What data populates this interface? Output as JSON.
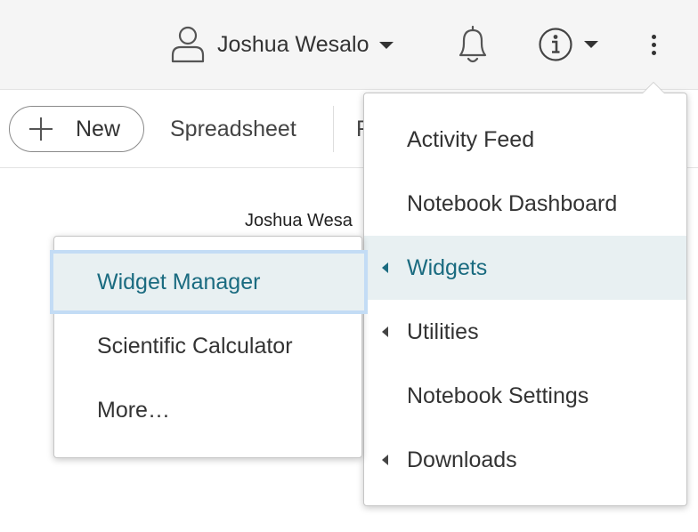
{
  "header": {
    "user_name": "Joshua Wesalo",
    "user_icon": "user-icon",
    "notifications_icon": "bell-icon",
    "info_icon": "info-icon",
    "more_icon": "kebab-menu-icon"
  },
  "toolbar": {
    "new_label": "New",
    "items": [
      "Spreadsheet",
      "F"
    ]
  },
  "content": {
    "user_name": "Joshua Wesa"
  },
  "main_menu": {
    "items": [
      {
        "label": "Activity Feed",
        "has_submenu": false
      },
      {
        "label": "Notebook Dashboard",
        "has_submenu": false
      },
      {
        "label": "Widgets",
        "has_submenu": true,
        "active": true
      },
      {
        "label": "Utilities",
        "has_submenu": true
      },
      {
        "label": "Notebook Settings",
        "has_submenu": false
      },
      {
        "label": "Downloads",
        "has_submenu": true
      }
    ]
  },
  "widgets_submenu": {
    "items": [
      {
        "label": "Widget Manager",
        "active": true
      },
      {
        "label": "Scientific Calculator"
      },
      {
        "label": "More…"
      }
    ]
  },
  "colors": {
    "accent_text": "#1a6b80",
    "active_bg": "#e8f0f2",
    "focus_ring": "#c3dcf5",
    "header_bg": "#f5f5f5"
  }
}
